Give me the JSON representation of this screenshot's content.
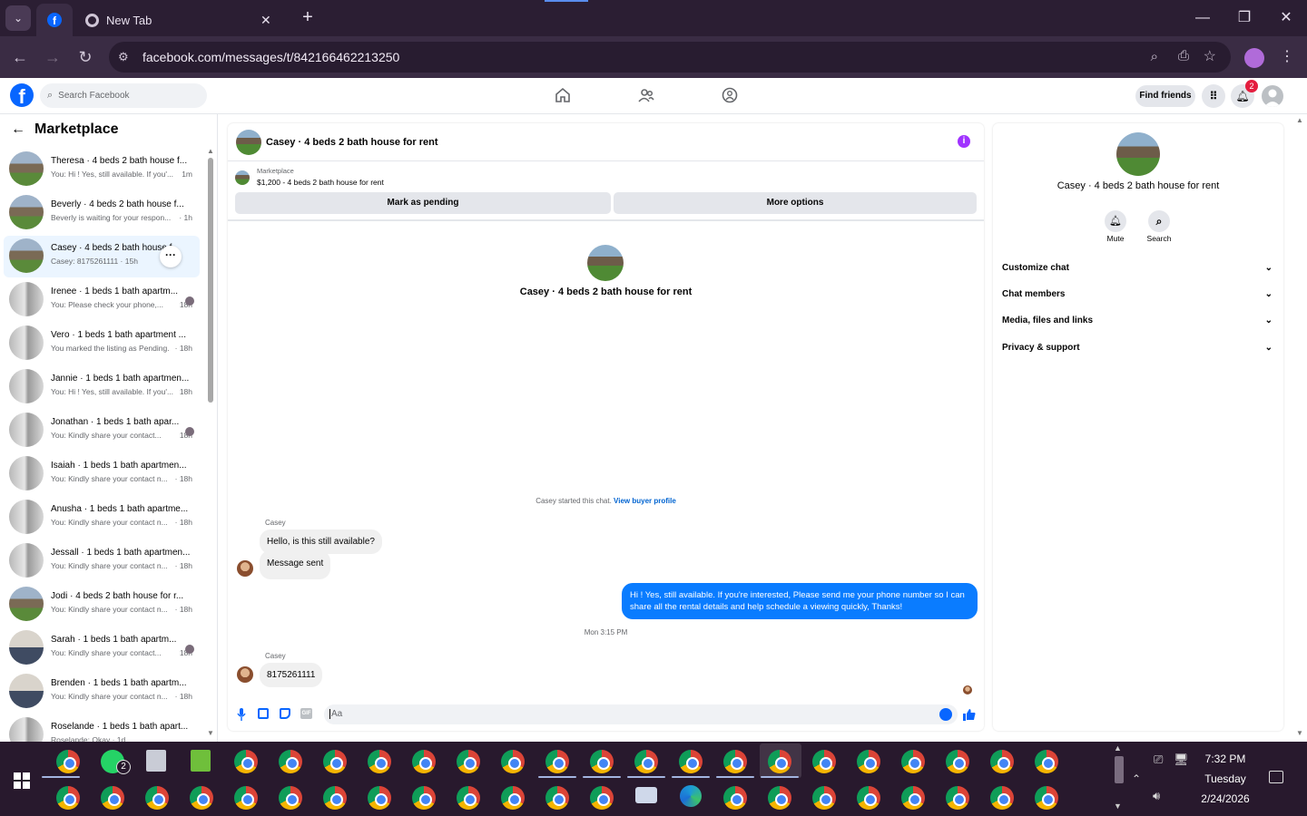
{
  "browser": {
    "tabs": [
      {
        "title": ""
      },
      {
        "title": "New Tab"
      }
    ],
    "url": "facebook.com/messages/t/842166462213250"
  },
  "fb": {
    "search_placeholder": "Search Facebook",
    "find_friends": "Find friends",
    "notification_count": "2",
    "brand_color": "#0866ff"
  },
  "sidebar": {
    "title": "Marketplace",
    "conversations": [
      {
        "name": "Theresa · 4 beds 2 bath house f...",
        "preview": "You: Hi ! Yes, still available. If you'...",
        "time": "1m"
      },
      {
        "name": "Beverly · 4 beds 2 bath house f...",
        "preview": "Beverly is waiting for your respon...",
        "time": "· 1h"
      },
      {
        "name": "Casey · 4 beds 2 bath house f...",
        "preview": "Casey: 8175261111 · 15h",
        "time": ""
      },
      {
        "name": "Irenee · 1 beds 1 bath apartm...",
        "preview": "You: Please check your phone,...",
        "time": "18h"
      },
      {
        "name": "Vero · 1 beds 1 bath apartment ...",
        "preview": "You marked the listing as Pending.",
        "time": "· 18h"
      },
      {
        "name": "Jannie · 1 beds 1 bath apartmen...",
        "preview": "You: Hi ! Yes, still available. If you'...",
        "time": "18h"
      },
      {
        "name": "Jonathan · 1 beds 1 bath apar...",
        "preview": "You: Kindly share your contact...",
        "time": "18h"
      },
      {
        "name": "Isaiah · 1 beds 1 bath apartmen...",
        "preview": "You: Kindly share your contact n...",
        "time": "· 18h"
      },
      {
        "name": "Anusha · 1 beds 1 bath apartme...",
        "preview": "You: Kindly share your contact n...",
        "time": "· 18h"
      },
      {
        "name": "Jessall · 1 beds 1 bath apartmen...",
        "preview": "You: Kindly share your contact n...",
        "time": "· 18h"
      },
      {
        "name": "Jodi · 4 beds 2 bath house for r...",
        "preview": "You: Kindly share your contact n...",
        "time": "· 18h"
      },
      {
        "name": "Sarah · 1 beds 1 bath apartm...",
        "preview": "You: Kindly share your contact...",
        "time": "18h"
      },
      {
        "name": "Brenden · 1 beds 1 bath apartm...",
        "preview": "You: Kindly share your contact n...",
        "time": "· 18h"
      },
      {
        "name": "Roselande · 1 beds 1 bath apart...",
        "preview": "Roselande: Okay · 1d",
        "time": ""
      }
    ]
  },
  "chat": {
    "header_title": "Casey · 4 beds 2 bath house for rent",
    "listing_label": "Marketplace",
    "listing_title": "$1,200 - 4 beds 2 bath house for rent",
    "mark_pending": "Mark as pending",
    "more_options": "More options",
    "intro_name": "Casey · 4 beds 2 bath house for rent",
    "started_text": "Casey started this chat.",
    "view_profile": "View buyer profile",
    "sender": "Casey",
    "msg1": "Hello, is this still available?",
    "msg2": "Message sent",
    "msg_out": "Hi ! Yes, still available. If you're interested, Please send me your phone number so I can share all the rental details and help schedule a viewing quickly, Thanks!",
    "timestamp": "Mon 3:15 PM",
    "sender2": "Casey",
    "msg3": "8175261111",
    "composer_placeholder": "Aa"
  },
  "details": {
    "name": "Casey · 4 beds 2 bath house for rent",
    "mute": "Mute",
    "search": "Search",
    "rows": [
      "Customize chat",
      "Chat members",
      "Media, files and links",
      "Privacy & support"
    ]
  },
  "taskbar": {
    "time": "7:32 PM",
    "day": "Tuesday",
    "date": "2/24/2026",
    "whatsapp_badge": "2"
  }
}
